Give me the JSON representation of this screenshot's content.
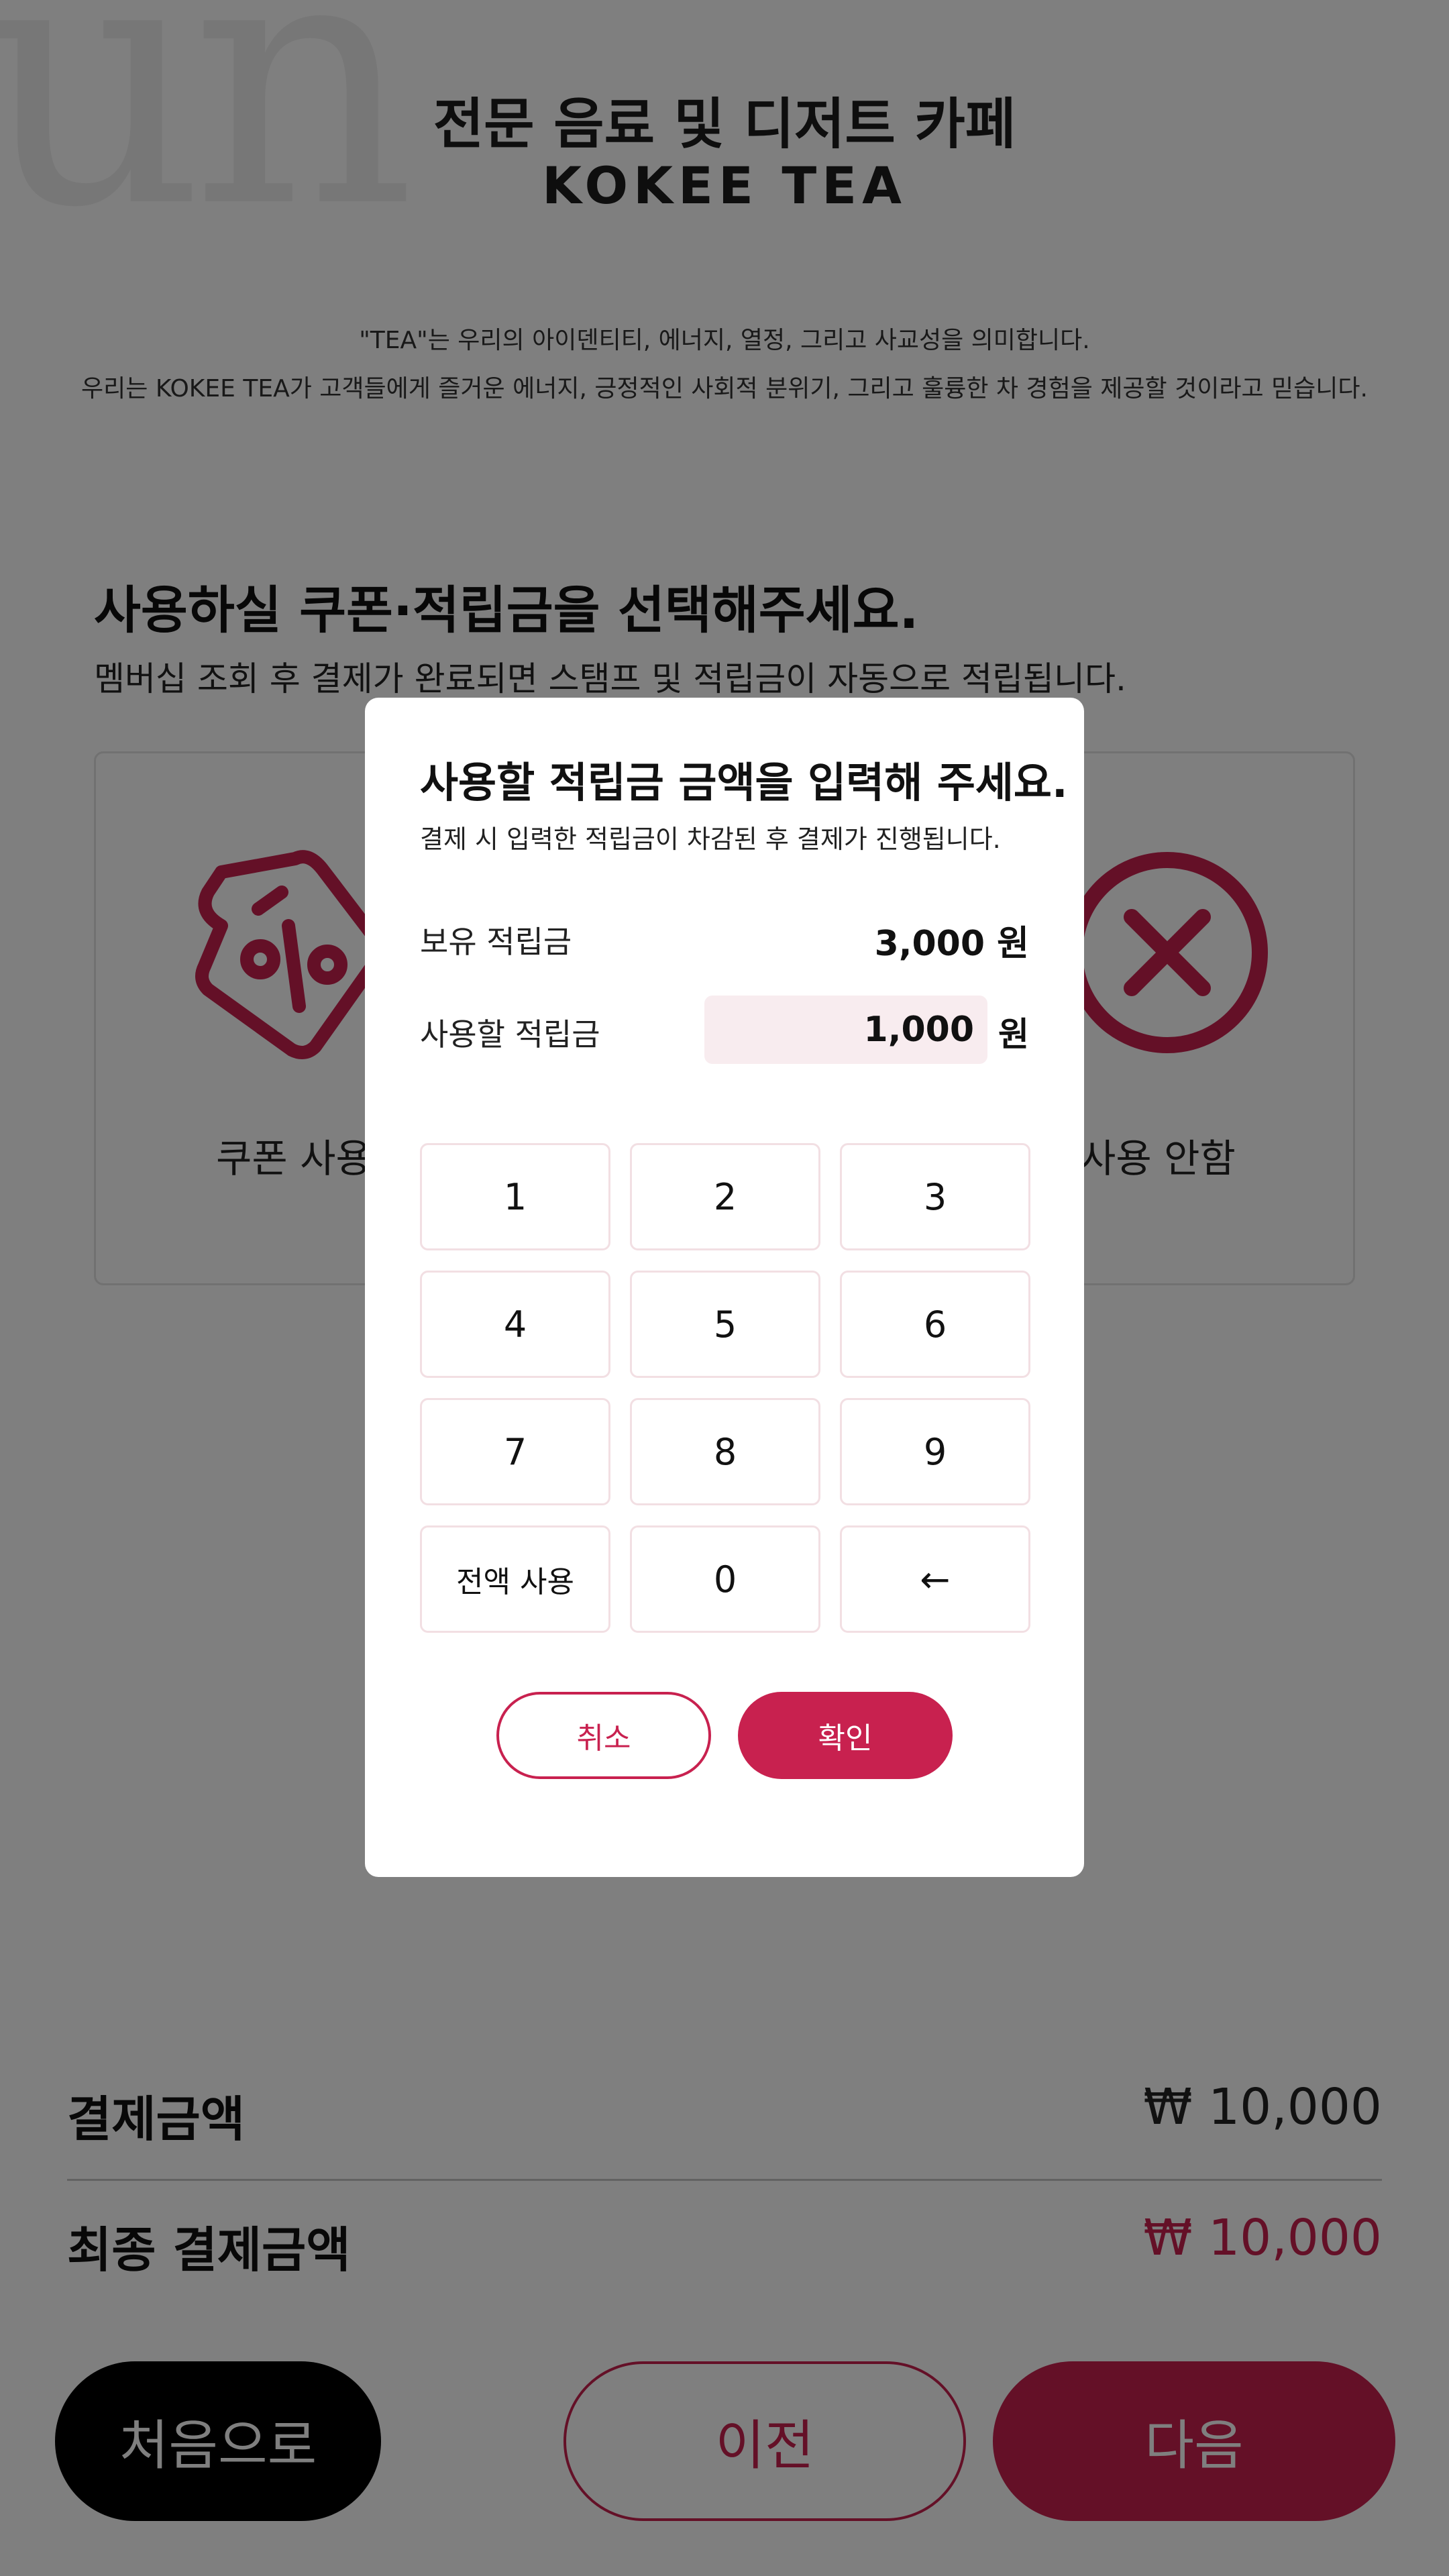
{
  "header": {
    "tagline": "전문 음료 및 디저트 카페",
    "brand": "KOKEE TEA",
    "intro_line1": "\"TEA\"는 우리의 아이덴티티, 에너지, 열정, 그리고 사교성을 의미합니다.",
    "intro_line2": "우리는 KOKEE TEA가 고객들에게 즐거운 에너지, 긍정적인 사회적 분위기, 그리고 훌륭한 차 경험을 제공할 것이라고 믿습니다."
  },
  "section": {
    "title": "사용하실 쿠폰·적립금을 선택해주세요.",
    "subtitle": "멤버십 조회 후 결제가 완료되면 스탬프 및 적립금이 자동으로 적립됩니다.",
    "options": [
      {
        "label": "쿠폰 사용",
        "icon": "coupon-percent-icon"
      },
      {
        "label": "사용 안함",
        "icon": "circle-x-icon"
      }
    ]
  },
  "summary": {
    "payment_label": "결제금액",
    "payment_value": "₩ 10,000",
    "final_label": "최종 결제금액",
    "final_value": "₩ 10,000"
  },
  "footer": {
    "home_label": "처음으로",
    "prev_label": "이전",
    "next_label": "다음"
  },
  "modal": {
    "title": "사용할 적립금 금액을 입력해 주세요.",
    "description": "결제 시 입력한 적립금이 차감된 후 결제가 진행됩니다.",
    "held_label": "보유 적립금",
    "held_value": "3,000 원",
    "use_label": "사용할 적립금",
    "use_value": "1,000",
    "use_unit": "원",
    "keys": [
      "1",
      "2",
      "3",
      "4",
      "5",
      "6",
      "7",
      "8",
      "9",
      "전액 사용",
      "0",
      "←"
    ],
    "cancel_label": "취소",
    "confirm_label": "확인"
  },
  "colors": {
    "accent": "#c8214f",
    "input_background": "#f8ecef",
    "overlay": "rgba(0,0,0,0.5)"
  }
}
